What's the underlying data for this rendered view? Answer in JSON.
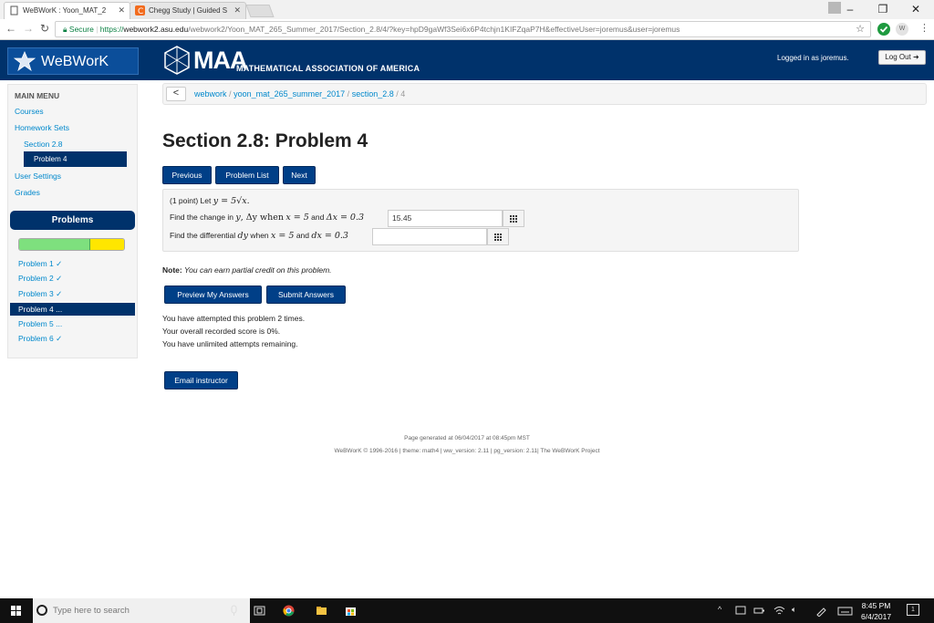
{
  "browser": {
    "tabs": [
      {
        "title": "WeBWorK : Yoon_MAT_2",
        "active": true
      },
      {
        "title": "Chegg Study | Guided S",
        "active": false
      }
    ],
    "secure_label": "Secure",
    "url_scheme": "https://",
    "url_host": "webwork2.asu.edu",
    "url_path": "/webwork2/Yoon_MAT_265_Summer_2017/Section_2.8/4/?key=hpD9gaWf3Sei6x6P4tchjn1KIFZqaP7H&effectiveUser=joremus&user=joremus",
    "controls": {
      "minimize": "–",
      "maximize": "❐",
      "close": "✕"
    },
    "ext_label": "W"
  },
  "header": {
    "logo_text": "WeBWorK",
    "maa_big": "MAA",
    "maa_small": "MATHEMATICAL ASSOCIATION OF AMERICA",
    "logged_in": "Logged in as joremus.",
    "logout_label": "Log Out"
  },
  "sidebar": {
    "title": "MAIN MENU",
    "links": {
      "courses": "Courses",
      "homework_sets": "Homework Sets",
      "section": "Section 2.8",
      "problem": "Problem 4",
      "user_settings": "User Settings",
      "grades": "Grades"
    },
    "problems_title": "Problems",
    "progress": {
      "correct_fraction": 0.667,
      "partial_fraction": 0.333,
      "colors": {
        "correct": "#7ee07e",
        "partial": "#ffe600"
      }
    },
    "problem_list": [
      {
        "label": "Problem 1 ✓",
        "selected": false
      },
      {
        "label": "Problem 2 ✓",
        "selected": false
      },
      {
        "label": "Problem 3 ✓",
        "selected": false
      },
      {
        "label": "Problem 4 ...",
        "selected": true
      },
      {
        "label": "Problem 5 ...",
        "selected": false
      },
      {
        "label": "Problem 6 ✓",
        "selected": false
      }
    ]
  },
  "breadcrumb": {
    "back": "<",
    "items": [
      "webwork",
      "yoon_mat_265_summer_2017",
      "section_2.8"
    ],
    "current": "4",
    "sep": "/"
  },
  "main": {
    "title": "Section 2.8: Problem 4",
    "nav": {
      "previous": "Previous",
      "list": "Problem List",
      "next": "Next"
    },
    "problem": {
      "points": "(1 point) Let",
      "let_expr": "y = 5√x.",
      "q1_prefix": "Find the change in",
      "q1_var": "y",
      "q1_mid": ", Δy when",
      "q1_cond": "x = 5",
      "q1_and": "and",
      "q1_delta": "Δx = 0.3",
      "q1_answer": "15.45",
      "q2_prefix": "Find the differential",
      "q2_var": "dy",
      "q2_when": "when",
      "q2_cond": "x = 5",
      "q2_and": "and",
      "q2_dx": "dx = 0.3",
      "q2_answer": ""
    },
    "note_label": "Note:",
    "note_text": "You can earn partial credit on this problem.",
    "preview_label": "Preview My Answers",
    "submit_label": "Submit Answers",
    "attempts": [
      "You have attempted this problem 2 times.",
      "Your overall recorded score is 0%.",
      "You have unlimited attempts remaining."
    ],
    "email_label": "Email instructor"
  },
  "footer": {
    "generated": "Page generated at 06/04/2017 at 08:45pm MST",
    "copyright": "WeBWorK © 1996-2016 | theme: math4 | ww_version: 2.11 | pg_version: 2.11| The WeBWorK Project"
  },
  "taskbar": {
    "search_placeholder": "Type here to search",
    "time": "8:45 PM",
    "date": "6/4/2017",
    "notif_count": "1"
  }
}
